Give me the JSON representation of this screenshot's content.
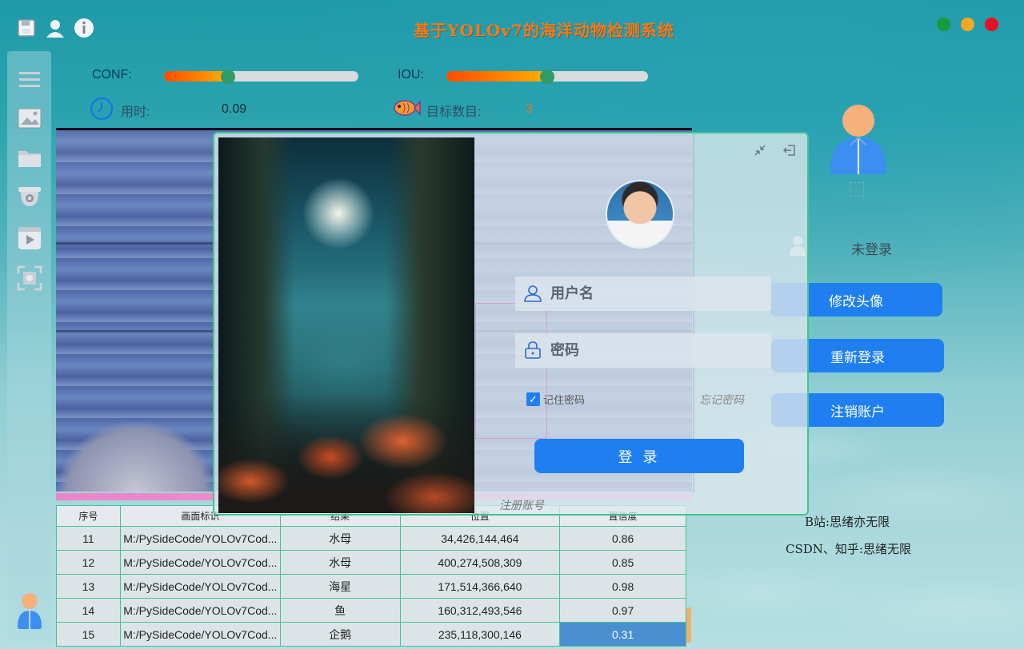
{
  "app": {
    "title": "基于YOLOv7的海洋动物检测系统"
  },
  "controls": {
    "conf_label": "CONF:",
    "conf_value": 0.33,
    "iou_label": "IOU:",
    "iou_value": 0.5,
    "time_label": "用时:",
    "time_value": "0.09",
    "count_label": "目标数目:",
    "count_value": "3"
  },
  "table": {
    "headers": [
      "序号",
      "画面标识",
      "结果",
      "位置",
      "置信度"
    ],
    "rows": [
      [
        "11",
        "M:/PySideCode/YOLOv7Cod...",
        "水母",
        "34,426,144,464",
        "0.86"
      ],
      [
        "12",
        "M:/PySideCode/YOLOv7Cod...",
        "水母",
        "400,274,508,309",
        "0.85"
      ],
      [
        "13",
        "M:/PySideCode/YOLOv7Cod...",
        "海星",
        "171,514,366,640",
        "0.98"
      ],
      [
        "14",
        "M:/PySideCode/YOLOv7Cod...",
        "鱼",
        "160,312,493,546",
        "0.97"
      ],
      [
        "15",
        "M:/PySideCode/YOLOv7Cod...",
        "企鹅",
        "235,118,300,146",
        "0.31"
      ]
    ]
  },
  "profile": {
    "status": "未登录",
    "change_avatar": "修改头像",
    "relogin": "重新登录",
    "delete_account": "注销账户",
    "credit_bilibili": "B站:思绪亦无限",
    "credit_csdn": "CSDN、知乎:思绪无限"
  },
  "login": {
    "username_placeholder": "用户名",
    "password_placeholder": "密码",
    "remember_label": "记住密码",
    "forgot_label": "忘记密码",
    "login_button": "登 录",
    "register_label": "注册账号"
  },
  "colors": {
    "accent": "#1f7ff0",
    "title": "#f07a1e",
    "table_border": "#3ec68f",
    "window_close": "#e81123",
    "window_min": "#f5a623",
    "window_max": "#1a9a3a"
  }
}
